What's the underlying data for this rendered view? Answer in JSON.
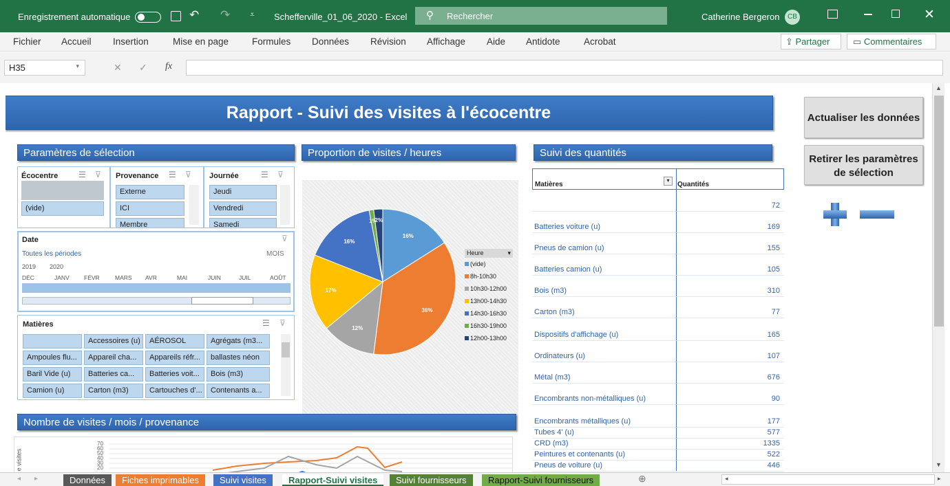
{
  "titlebar": {
    "autosave": "Enregistrement automatique",
    "filename": "Schefferville_01_06_2020  -  Excel",
    "search": "Rechercher",
    "user": "Catherine Bergeron",
    "initials": "CB"
  },
  "ribbon": {
    "tabs": [
      "Fichier",
      "Accueil",
      "Insertion",
      "Mise en page",
      "Formules",
      "Données",
      "Révision",
      "Affichage",
      "Aide",
      "Antidote",
      "Acrobat"
    ],
    "share": "Partager",
    "comments": "Commentaires"
  },
  "formula": {
    "namebox": "H35",
    "fx": "fx"
  },
  "report": {
    "title": "Rapport - Suivi des visites à l'écocentre",
    "btn_refresh": "Actualiser les données",
    "btn_clear": "Retirer les paramètres de sélection"
  },
  "params": {
    "title": "Paramètres de sélection",
    "ecocentre": {
      "label": "Écocentre",
      "items": [
        "(vide)"
      ]
    },
    "provenance": {
      "label": "Provenance",
      "items": [
        "Externe",
        "ICI",
        "Membre"
      ]
    },
    "journee": {
      "label": "Journée",
      "items": [
        "Jeudi",
        "Vendredi",
        "Samedi"
      ]
    },
    "date": {
      "label": "Date",
      "periods": "Toutes les périodes",
      "unit": "MOIS",
      "years": [
        "2019",
        "2020"
      ],
      "months": [
        "DÉC",
        "JANV",
        "FÉVR",
        "MARS",
        "AVR",
        "MAI",
        "JUIN",
        "JUIL",
        "AOÛT"
      ]
    },
    "matieres": {
      "label": "Matières",
      "items": [
        "",
        "Accessoires (u)",
        "AÉROSOL",
        "Agrégats (m3...",
        "Ampoules flu...",
        "Appareil cha...",
        "Appareils réfr...",
        "ballastes néon",
        "Baril Vide (u)",
        "Batteries ca...",
        "Batteries voit...",
        "Bois (m3)",
        "Camion (u)",
        "Carton (m3)",
        "Cartouches d'...",
        "Contenants a..."
      ]
    }
  },
  "pie": {
    "title": "Proportion de visites / heures",
    "legend_title": "Heure",
    "legend": [
      "(vide)",
      "8h-10h30",
      "10h30-12h00",
      "13h00-14h30",
      "14h30-16h30",
      "16h30-19h00",
      "12h00-13h00"
    ],
    "labels": [
      "16%",
      "36%",
      "12%",
      "17%",
      "16%",
      "1%",
      "2%"
    ]
  },
  "chart_data": {
    "type": "pie",
    "categories": [
      "(vide)",
      "8h-10h30",
      "10h30-12h00",
      "13h00-14h30",
      "14h30-16h30",
      "16h30-19h00",
      "12h00-13h00"
    ],
    "values": [
      16,
      36,
      12,
      17,
      16,
      1,
      2
    ],
    "colors": [
      "#5b9bd5",
      "#ed7d31",
      "#a5a5a5",
      "#ffc000",
      "#4472c4",
      "#70ad47",
      "#264478"
    ],
    "title": "",
    "legend_title": "Heure"
  },
  "quant": {
    "title": "Suivi des quantités",
    "col1": "Matières",
    "col2": "Quantités",
    "rows": [
      [
        "",
        "72"
      ],
      [
        "Batteries voiture (u)",
        "169"
      ],
      [
        "Pneus de camion (u)",
        "155"
      ],
      [
        "Batteries camion (u)",
        "105"
      ],
      [
        "Bois (m3)",
        "310"
      ],
      [
        "Carton (m3)",
        "77"
      ],
      [
        "Dispositifs d'affichage (u)",
        "165"
      ],
      [
        "Ordinateurs (u)",
        "107"
      ],
      [
        "Métal (m3)",
        "676"
      ],
      [
        "Encombrants non-métalliques (u)",
        "90"
      ],
      [
        "Encombrants métalliques (u)",
        "177"
      ],
      [
        "Tubes 4' (u)",
        "577"
      ],
      [
        "CRD (m3)",
        "1335"
      ],
      [
        "Peintures et contenants (u)",
        "522"
      ],
      [
        "Pneus de voiture (u)",
        "446"
      ]
    ]
  },
  "visits": {
    "title": "Nombre de visites / mois / provenance",
    "ylabel": "e visites",
    "yticks": [
      "70",
      "60",
      "50",
      "40",
      "30",
      "20"
    ]
  },
  "sheets": [
    {
      "name": "Données",
      "bg": "#595959",
      "fg": "#fff"
    },
    {
      "name": "Fiches imprimables",
      "bg": "#ed7d31",
      "fg": "#fff"
    },
    {
      "name": "Suivi visites",
      "bg": "#4472c4",
      "fg": "#fff"
    },
    {
      "name": "Rapport-Suivi visites",
      "bg": "#ffffff",
      "fg": "#217346"
    },
    {
      "name": "Suivi fournisseurs",
      "bg": "#548235",
      "fg": "#fff"
    },
    {
      "name": "Rapport-Suivi fournisseurs",
      "bg": "#70ad47",
      "fg": "#111"
    }
  ]
}
